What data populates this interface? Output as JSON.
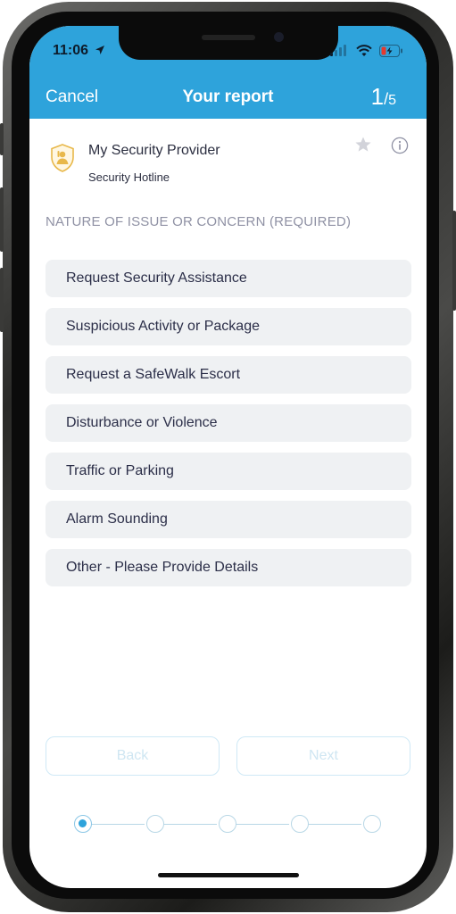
{
  "status_bar": {
    "time": "11:06"
  },
  "nav": {
    "cancel_label": "Cancel",
    "title": "Your report",
    "step_current": "1",
    "step_separator": "/",
    "step_total": "5"
  },
  "provider": {
    "name": "My Security Provider",
    "subtitle": "Security Hotline",
    "icon": "shield-icon"
  },
  "section_label": "NATURE OF ISSUE OR CONCERN (REQUIRED)",
  "options": [
    {
      "label": "Request Security Assistance"
    },
    {
      "label": "Suspicious Activity or Package"
    },
    {
      "label": "Request a SafeWalk Escort"
    },
    {
      "label": "Disturbance or Violence"
    },
    {
      "label": "Traffic or Parking"
    },
    {
      "label": "Alarm Sounding"
    },
    {
      "label": "Other - Please Provide Details"
    }
  ],
  "buttons": {
    "back_label": "Back",
    "next_label": "Next"
  },
  "stepper": {
    "current_step": 1,
    "total_steps": 5
  },
  "colors": {
    "accent": "#2ea3db",
    "option_bg": "#eff1f3",
    "section_label": "#8f91a4",
    "shield": "#e8b84a"
  }
}
